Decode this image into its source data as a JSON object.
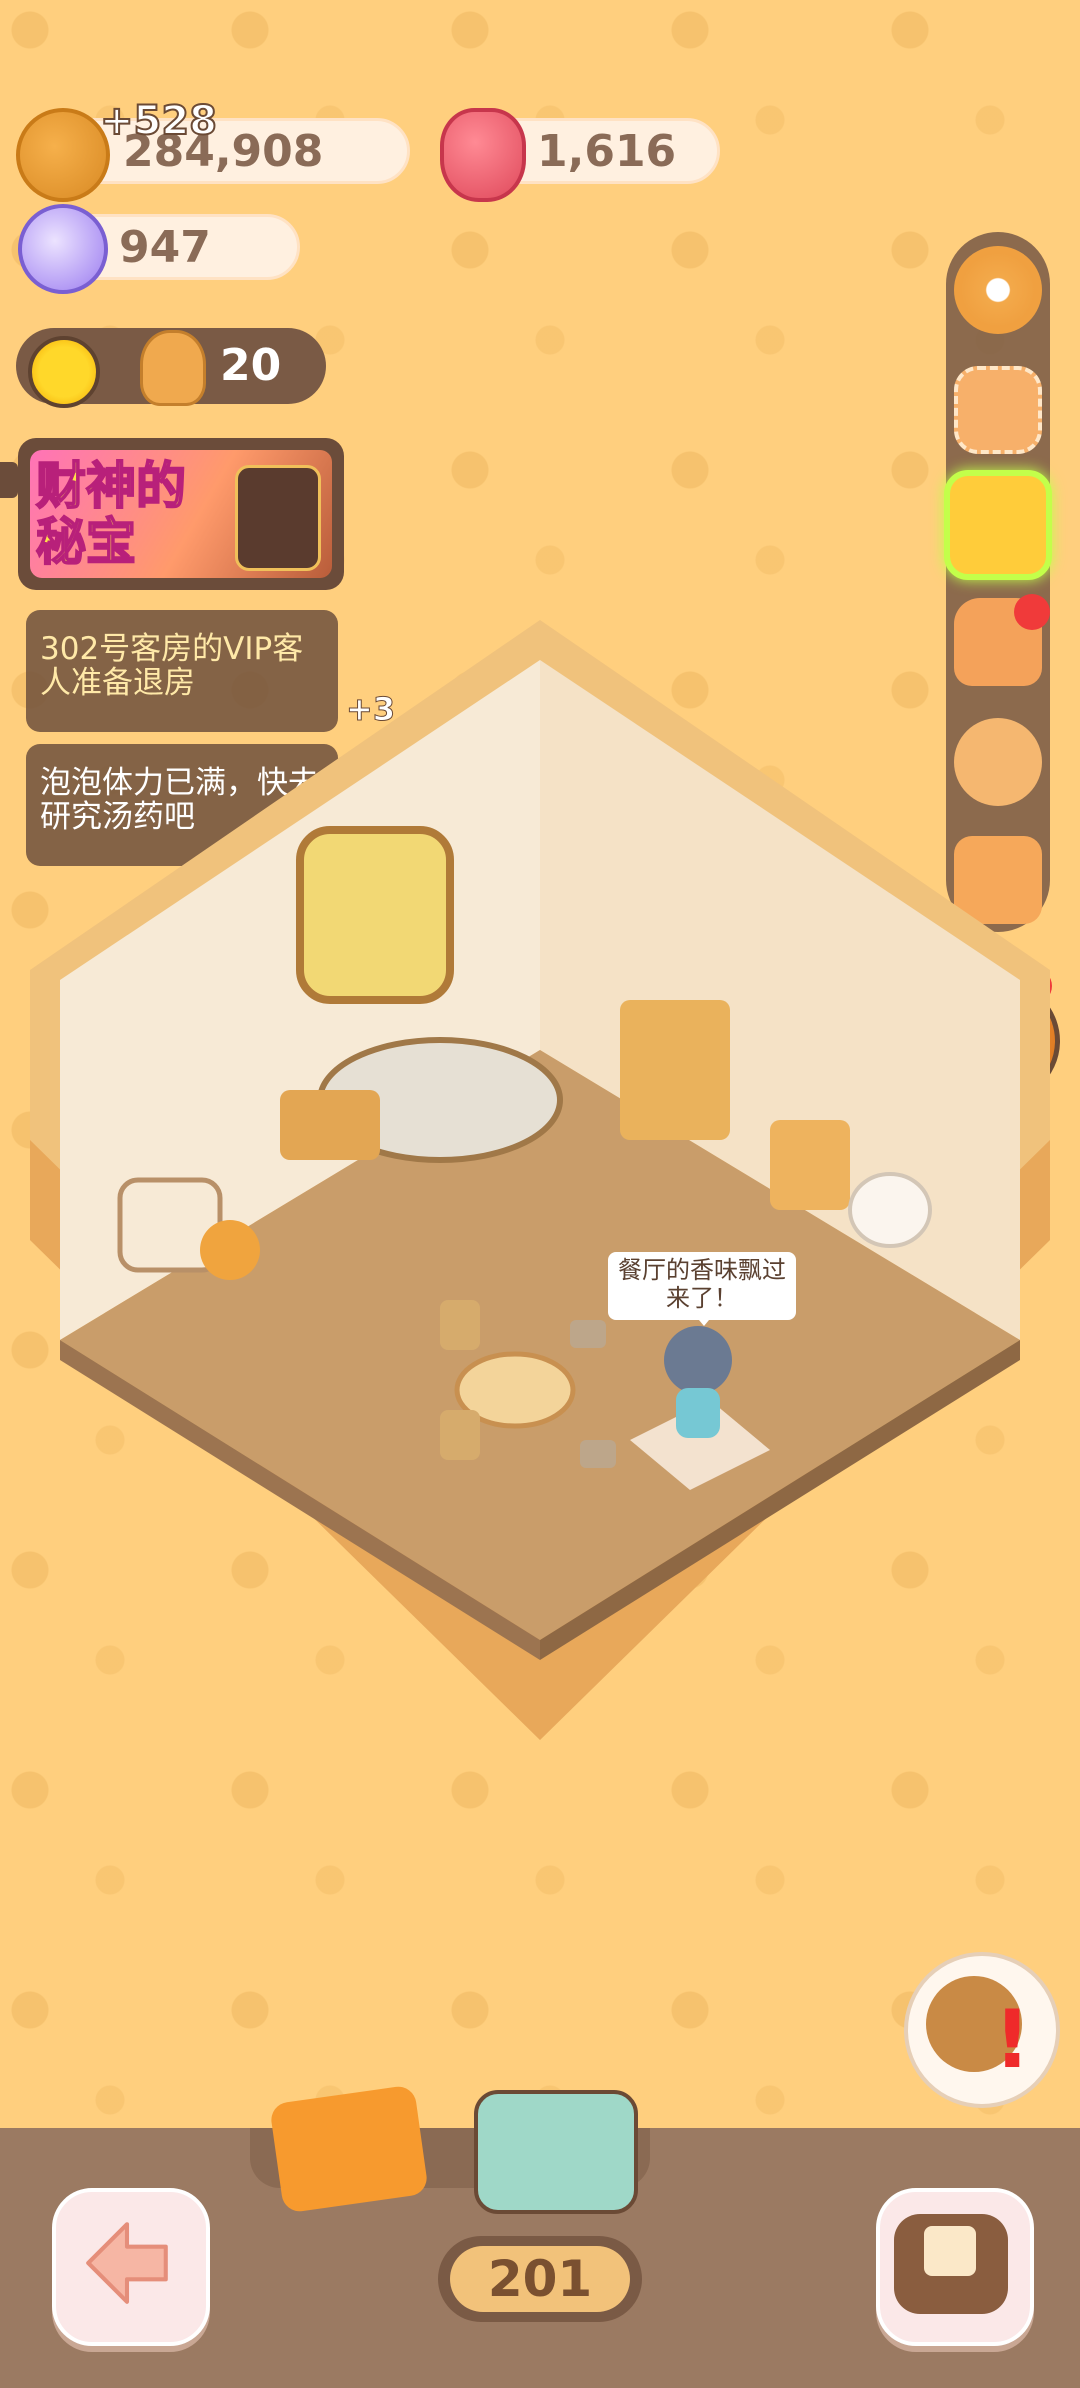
{
  "currencies": {
    "cookies": "284,908",
    "cookie_gain": "+528",
    "gems": "1,616",
    "candy": "947"
  },
  "energy": {
    "count": "20"
  },
  "event_banner": {
    "title": "财神的秘宝"
  },
  "notices": [
    {
      "text": "302号客房的VIP客人准备退房"
    },
    {
      "text": "泡泡体力已满，快去研究汤药吧"
    }
  ],
  "notice_bonus": "+3",
  "side_menu": {
    "items": [
      {
        "icon": "gear-icon"
      },
      {
        "icon": "stamp-icon"
      },
      {
        "icon": "star-icon"
      },
      {
        "icon": "bag-icon",
        "badge": true
      },
      {
        "icon": "friends-icon"
      },
      {
        "icon": "camera-icon"
      }
    ]
  },
  "speech_bubble": {
    "text": "餐厅的香味飘过来了！"
  },
  "bottom_bar": {
    "level": "201"
  },
  "colors": {
    "background": "#ffcf7e",
    "panel_brown": "#7a5a45",
    "notification_red": "#f03a3a",
    "selected_glow": "#c3ff4a"
  }
}
